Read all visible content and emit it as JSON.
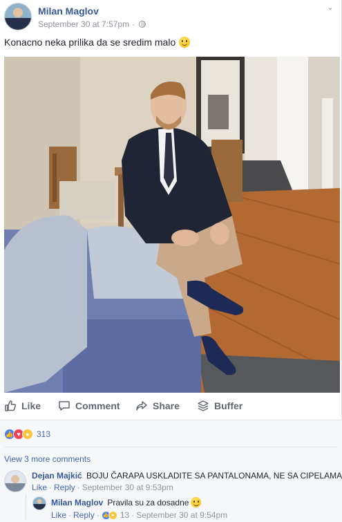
{
  "post": {
    "author": "Milan Maglov",
    "timestamp": "September 30 at 7:57pm",
    "separator": "·",
    "text": "Konacno neka prilika da se sredim malo"
  },
  "actions": {
    "like_label": "Like",
    "comment_label": "Comment",
    "share_label": "Share",
    "buffer_label": "Buffer"
  },
  "reactions": {
    "count": "313",
    "types": [
      "like",
      "love",
      "wow"
    ]
  },
  "view_more_label": "View 3 more comments",
  "comments": [
    {
      "author": "Dejan Majkić",
      "text": "BOJU ČARAPA USKLADITE SA PANTALONAMA, NE SA CIPELAMA",
      "like_label": "Like",
      "reply_label": "Reply",
      "separator": "·",
      "timestamp": "September 30 at 9:53pm"
    }
  ],
  "reply": {
    "author": "Milan Maglov",
    "text": "Pravila su za dosadne",
    "like_label": "Like",
    "reply_label": "Reply",
    "separator": "·",
    "reaction_count": "13",
    "timestamp": "September 30 at 9:54pm"
  },
  "colors": {
    "link_blue": "#365899",
    "like_blue": "#4c80f1",
    "love_red": "#f0425a",
    "wow_yellow": "#f7c83f",
    "meta_gray": "#90949c"
  }
}
